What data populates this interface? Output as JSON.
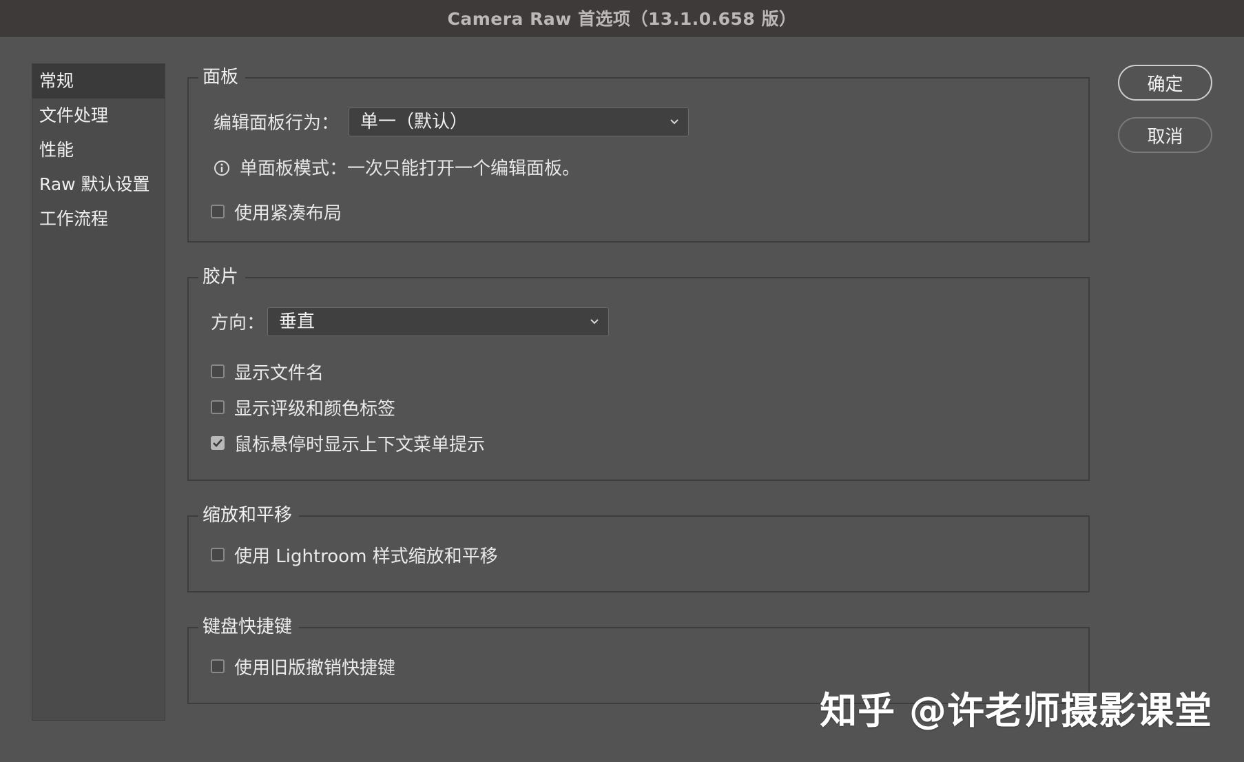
{
  "window": {
    "title": "Camera Raw 首选项（13.1.0.658 版）"
  },
  "sidebar": {
    "items": [
      {
        "label": "常规",
        "active": true
      },
      {
        "label": "文件处理"
      },
      {
        "label": "性能"
      },
      {
        "label": "Raw 默认设置"
      },
      {
        "label": "工作流程"
      }
    ]
  },
  "panels": {
    "title": "面板",
    "edit_behavior_label": "编辑面板行为：",
    "edit_behavior_value": "单一（默认）",
    "info_text": "单面板模式：一次只能打开一个编辑面板。",
    "compact_layout_label": "使用紧凑布局",
    "compact_layout_checked": false
  },
  "filmstrip": {
    "title": "胶片",
    "orientation_label": "方向：",
    "orientation_value": "垂直",
    "show_filename_label": "显示文件名",
    "show_filename_checked": false,
    "show_ratings_label": "显示评级和颜色标签",
    "show_ratings_checked": false,
    "hover_tips_label": "鼠标悬停时显示上下文菜单提示",
    "hover_tips_checked": true
  },
  "zoom_pan": {
    "title": "缩放和平移",
    "lightroom_style_label": "使用 Lightroom 样式缩放和平移",
    "lightroom_style_checked": false
  },
  "keyboard": {
    "title": "键盘快捷键",
    "legacy_undo_label": "使用旧版撤销快捷键",
    "legacy_undo_checked": false
  },
  "buttons": {
    "ok_label": "确定",
    "cancel_label": "取消"
  },
  "watermark": {
    "text": "知乎 @许老师摄影课堂"
  },
  "colors": {
    "background": "#535353",
    "titlebar": "#3f3a3a",
    "sidebar_bg": "#4b4b4b",
    "sidebar_active": "#3a3a3a",
    "group_border": "#3d3d3d",
    "select_bg": "#404040"
  }
}
